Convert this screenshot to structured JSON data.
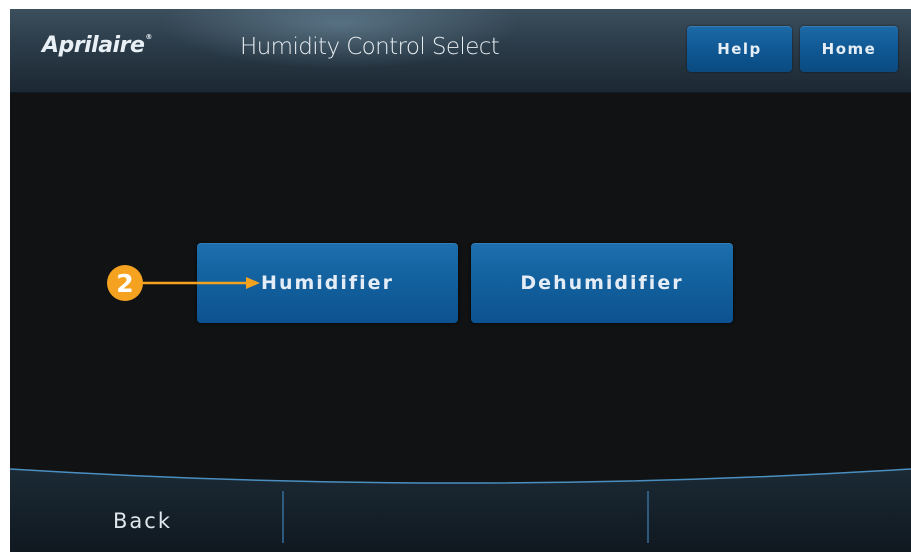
{
  "header": {
    "logo": "Aprilaire",
    "logo_mark": "®",
    "title": "Humidity Control Select",
    "help_label": "Help",
    "home_label": "Home"
  },
  "main": {
    "humidifier_label": "Humidifier",
    "dehumidifier_label": "Dehumidifier"
  },
  "annotation": {
    "callout_number": "2",
    "callout_color": "#f4a21f"
  },
  "footer": {
    "back_label": "Back"
  },
  "colors": {
    "button_blue": "#12609d",
    "background": "#111213",
    "header": "#2b3b48"
  }
}
